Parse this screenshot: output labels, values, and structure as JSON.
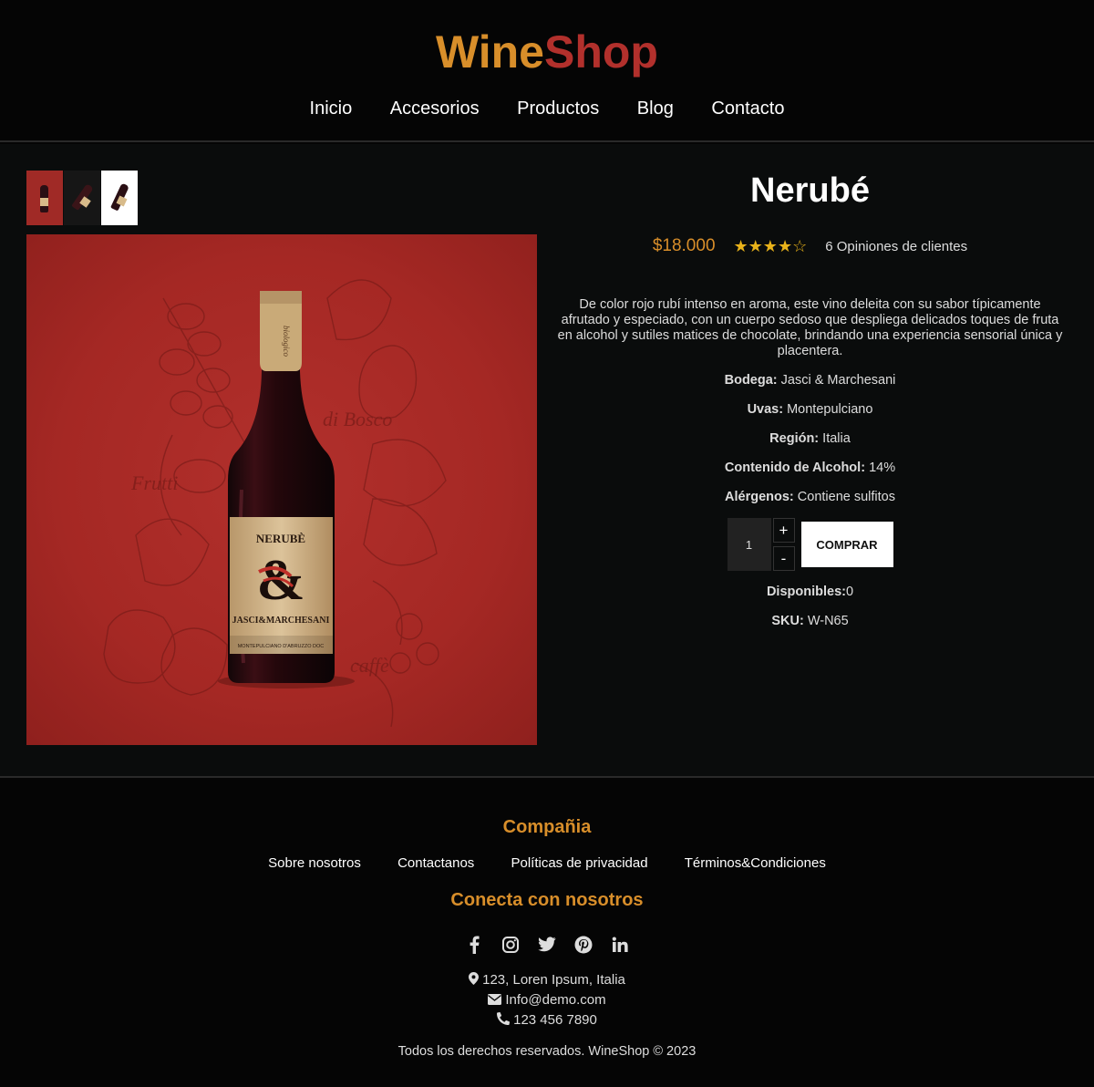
{
  "header": {
    "logo_part1": "Wine",
    "logo_part2": "Shop",
    "nav": [
      "Inicio",
      "Accesorios",
      "Productos",
      "Blog",
      "Contacto"
    ]
  },
  "product": {
    "title": "Nerubé",
    "price": "$18.000",
    "rating": 4,
    "rating_max": 5,
    "reviews": "6 Opiniones de clientes",
    "description": "De color rojo rubí intenso en aroma, este vino deleita con su sabor típicamente afrutado y especiado, con un cuerpo sedoso que despliega delicados toques de fruta en alcohol y sutiles matices de chocolate, brindando una experiencia sensorial única y placentera.",
    "specs": [
      {
        "label": "Bodega:",
        "value": "Jasci & Marchesani"
      },
      {
        "label": "Uvas:",
        "value": "Montepulciano"
      },
      {
        "label": "Región:",
        "value": "Italia"
      },
      {
        "label": "Contenido de Alcohol:",
        "value": "14%"
      },
      {
        "label": "Alérgenos:",
        "value": "Contiene sulfitos"
      }
    ],
    "quantity": "1",
    "plus": "+",
    "minus": "-",
    "buy_label": "COMPRAR",
    "stock_label": "Disponibles:",
    "stock_value": "0",
    "sku_label": "SKU:",
    "sku_value": "W-N65"
  },
  "image": {
    "label_name": "NERUBÈ",
    "label_winery": "JASCI&MARCHESANI",
    "label_doc": "MONTEPULCIANO D'ABRUZZO DOC",
    "neck_text": "biologico",
    "word1": "di Bosco",
    "word2": "Frutti",
    "word3": "caffè"
  },
  "footer": {
    "company_heading": "Compañia",
    "links": [
      "Sobre nosotros",
      "Contactanos",
      "Políticas de privacidad",
      "Términos&Condiciones"
    ],
    "connect_heading": "Conecta con nosotros",
    "social": [
      "facebook-icon",
      "instagram-icon",
      "twitter-icon",
      "pinterest-icon",
      "linkedin-icon"
    ],
    "address": "123, Loren Ipsum, Italia",
    "email": "Info@demo.com",
    "phone": "123 456 7890",
    "copyright": "Todos los derechos reservados. WineShop © 2023"
  },
  "colors": {
    "accent": "#d88e2a",
    "brand_red": "#b2302c",
    "star": "#e8b21a",
    "background": "#050505"
  }
}
